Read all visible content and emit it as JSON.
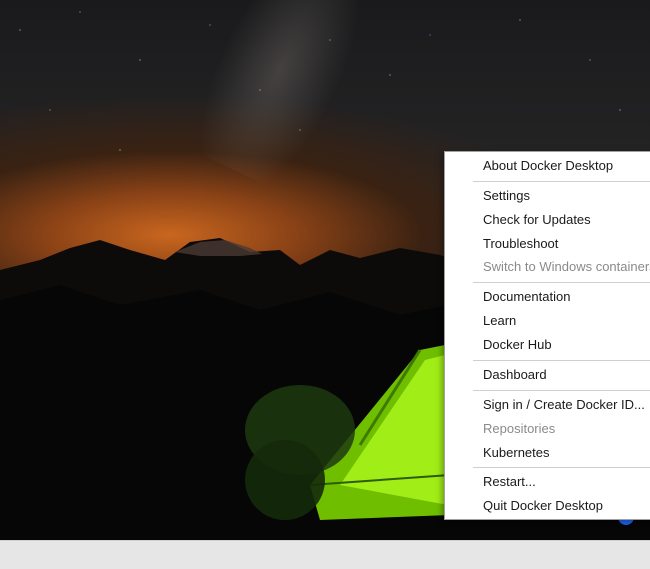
{
  "context_menu": {
    "items": [
      {
        "label": "About Docker Desktop",
        "enabled": true
      },
      {
        "label": "Settings",
        "enabled": true
      },
      {
        "label": "Check for Updates",
        "enabled": true
      },
      {
        "label": "Troubleshoot",
        "enabled": true
      },
      {
        "label": "Switch to Windows containers",
        "enabled": false
      },
      {
        "label": "Documentation",
        "enabled": true
      },
      {
        "label": "Learn",
        "enabled": true
      },
      {
        "label": "Docker Hub",
        "enabled": true
      },
      {
        "label": "Dashboard",
        "enabled": true
      },
      {
        "label": "Sign in / Create Docker ID...",
        "enabled": true
      },
      {
        "label": "Repositories",
        "enabled": false
      },
      {
        "label": "Kubernetes",
        "enabled": true
      },
      {
        "label": "Restart...",
        "enabled": true
      },
      {
        "label": "Quit Docker Desktop",
        "enabled": true
      }
    ]
  },
  "tray": {
    "icon": "docker-whale-icon",
    "color": "#1d63ed"
  },
  "colors": {
    "tent_glow": "#8fe000",
    "horizon": "#c9661f",
    "menu_bg": "#ffffff",
    "disabled_text": "#8a8a8a"
  }
}
